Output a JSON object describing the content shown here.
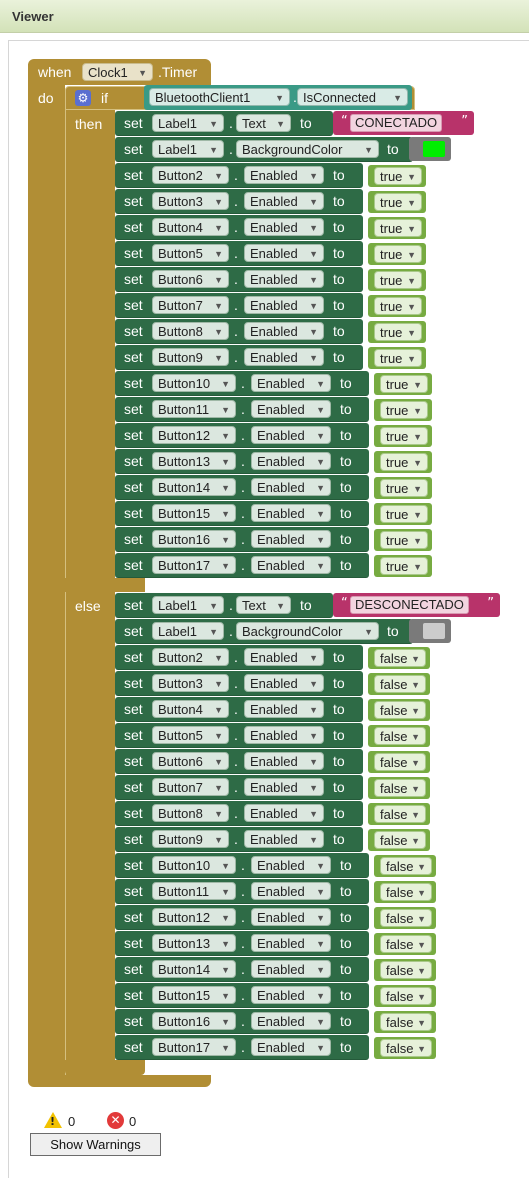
{
  "panel": {
    "title": "Viewer"
  },
  "event": {
    "when": "when",
    "component": "Clock1",
    "event_name": ".Timer",
    "do": "do"
  },
  "if_block": {
    "if_label": "if",
    "then_label": "then",
    "else_label": "else",
    "condition": {
      "component": "BluetoothClient1",
      "dot": ".",
      "property": "IsConnected"
    }
  },
  "labels": {
    "set": "set",
    "to": "to",
    "dot": "."
  },
  "then_rows": {
    "label_text": {
      "component": "Label1",
      "property": "Text",
      "value": "CONECTADO"
    },
    "label_color": {
      "component": "Label1",
      "property": "BackgroundColor",
      "color": "#00ee00"
    },
    "buttons": [
      {
        "component": "Button2",
        "property": "Enabled",
        "value": "true"
      },
      {
        "component": "Button3",
        "property": "Enabled",
        "value": "true"
      },
      {
        "component": "Button4",
        "property": "Enabled",
        "value": "true"
      },
      {
        "component": "Button5",
        "property": "Enabled",
        "value": "true"
      },
      {
        "component": "Button6",
        "property": "Enabled",
        "value": "true"
      },
      {
        "component": "Button7",
        "property": "Enabled",
        "value": "true"
      },
      {
        "component": "Button8",
        "property": "Enabled",
        "value": "true"
      },
      {
        "component": "Button9",
        "property": "Enabled",
        "value": "true"
      },
      {
        "component": "Button10",
        "property": "Enabled",
        "value": "true"
      },
      {
        "component": "Button11",
        "property": "Enabled",
        "value": "true"
      },
      {
        "component": "Button12",
        "property": "Enabled",
        "value": "true"
      },
      {
        "component": "Button13",
        "property": "Enabled",
        "value": "true"
      },
      {
        "component": "Button14",
        "property": "Enabled",
        "value": "true"
      },
      {
        "component": "Button15",
        "property": "Enabled",
        "value": "true"
      },
      {
        "component": "Button16",
        "property": "Enabled",
        "value": "true"
      },
      {
        "component": "Button17",
        "property": "Enabled",
        "value": "true"
      }
    ]
  },
  "else_rows": {
    "label_text": {
      "component": "Label1",
      "property": "Text",
      "value": "DESCONECTADO"
    },
    "label_color": {
      "component": "Label1",
      "property": "BackgroundColor",
      "color": "#cccccc"
    },
    "buttons": [
      {
        "component": "Button2",
        "property": "Enabled",
        "value": "false"
      },
      {
        "component": "Button3",
        "property": "Enabled",
        "value": "false"
      },
      {
        "component": "Button4",
        "property": "Enabled",
        "value": "false"
      },
      {
        "component": "Button5",
        "property": "Enabled",
        "value": "false"
      },
      {
        "component": "Button6",
        "property": "Enabled",
        "value": "false"
      },
      {
        "component": "Button7",
        "property": "Enabled",
        "value": "false"
      },
      {
        "component": "Button8",
        "property": "Enabled",
        "value": "false"
      },
      {
        "component": "Button9",
        "property": "Enabled",
        "value": "false"
      },
      {
        "component": "Button10",
        "property": "Enabled",
        "value": "false"
      },
      {
        "component": "Button11",
        "property": "Enabled",
        "value": "false"
      },
      {
        "component": "Button12",
        "property": "Enabled",
        "value": "false"
      },
      {
        "component": "Button13",
        "property": "Enabled",
        "value": "false"
      },
      {
        "component": "Button14",
        "property": "Enabled",
        "value": "false"
      },
      {
        "component": "Button15",
        "property": "Enabled",
        "value": "false"
      },
      {
        "component": "Button16",
        "property": "Enabled",
        "value": "false"
      },
      {
        "component": "Button17",
        "property": "Enabled",
        "value": "false"
      }
    ]
  },
  "status": {
    "warnings_count": "0",
    "errors_count": "0",
    "show_warnings_label": "Show Warnings",
    "warning_icon": "warning-icon",
    "error_icon": "error-icon"
  }
}
